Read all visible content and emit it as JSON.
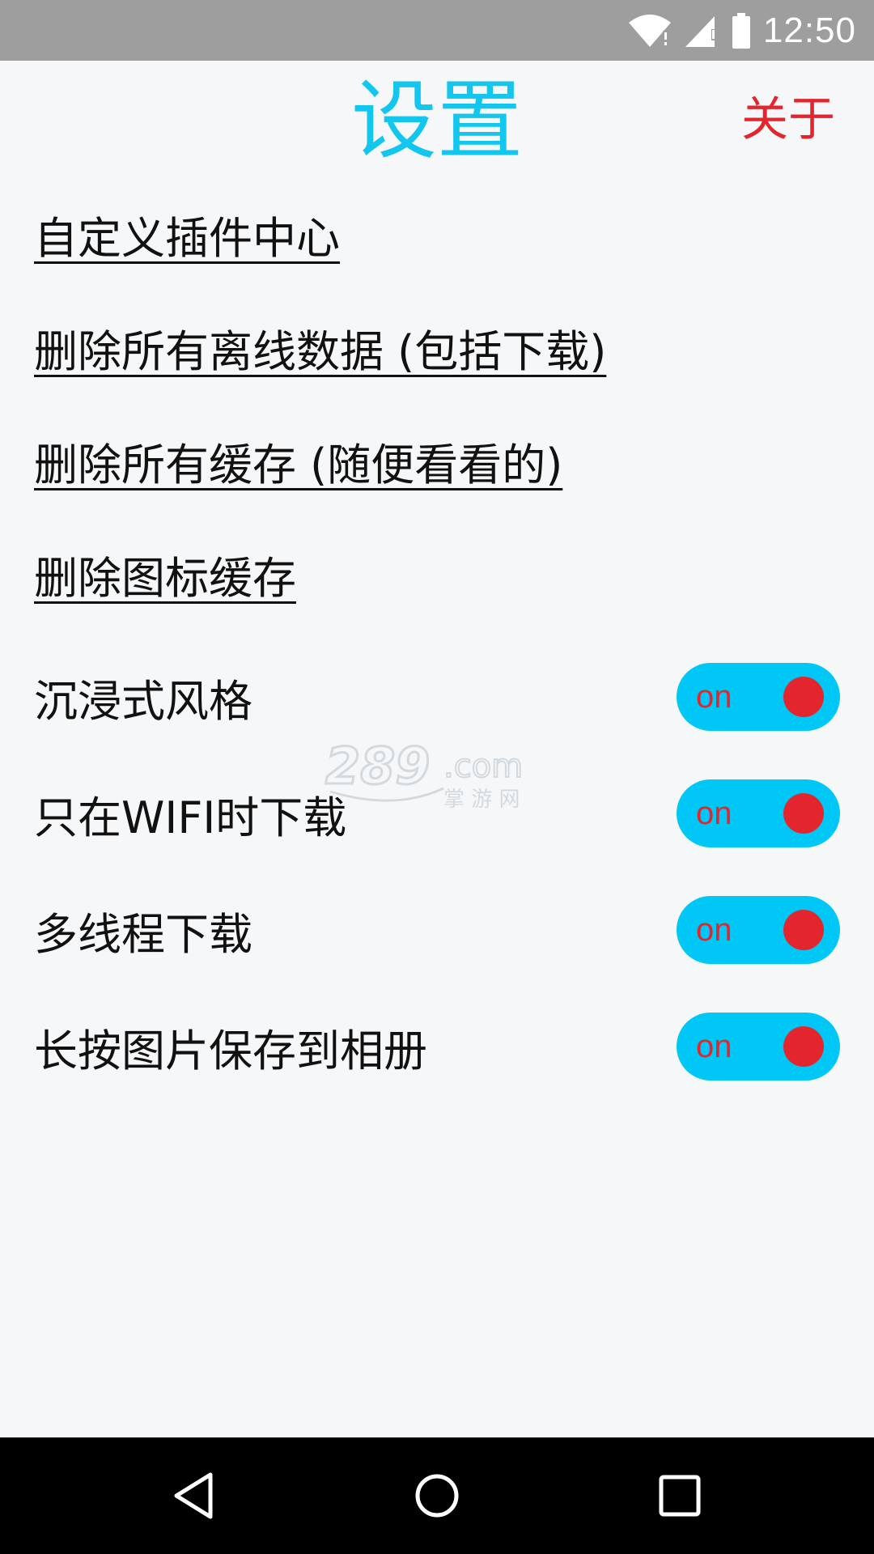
{
  "status_bar": {
    "time": "12:50",
    "icons": [
      "wifi-icon",
      "signal-icon",
      "battery-icon"
    ]
  },
  "header": {
    "title": "设置",
    "about_label": "关于"
  },
  "links": [
    {
      "label": "自定义插件中心"
    },
    {
      "label": "删除所有离线数据 (包括下载)"
    },
    {
      "label": "删除所有缓存 (随便看看的)"
    },
    {
      "label": "删除图标缓存"
    }
  ],
  "toggles": [
    {
      "label": "沉浸式风格",
      "state": "on"
    },
    {
      "label": "只在WIFI时下载",
      "state": "on"
    },
    {
      "label": "多线程下载",
      "state": "on"
    },
    {
      "label": "长按图片保存到相册",
      "state": "on"
    }
  ],
  "watermark": {
    "text": "289.com",
    "sub": "掌游网"
  },
  "nav_bar": {
    "icons": [
      "back-icon",
      "home-icon",
      "recents-icon"
    ]
  },
  "colors": {
    "title": "#12c6ee",
    "about": "#e3262d",
    "switch_bg": "#00c7f5",
    "switch_knob": "#e3262d",
    "status_bar": "#9e9e9e",
    "nav_bar": "#000000"
  }
}
